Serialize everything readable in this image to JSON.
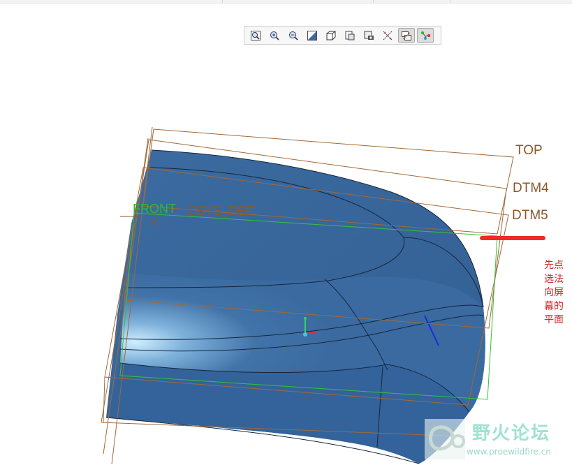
{
  "toolbar": {
    "buttons": [
      {
        "icon": "refit-icon",
        "active": false
      },
      {
        "icon": "zoom-in-icon",
        "active": false
      },
      {
        "icon": "zoom-out-icon",
        "active": false
      },
      {
        "icon": "repaint-icon",
        "active": false
      },
      {
        "icon": "display-style-icon",
        "active": false
      },
      {
        "icon": "saved-orientations-icon",
        "active": false
      },
      {
        "icon": "view-manager-icon",
        "active": false
      },
      {
        "icon": "perspective-icon",
        "active": false
      },
      {
        "icon": "datum-display-icon",
        "active": true
      },
      {
        "icon": "spin-center-icon",
        "active": true
      }
    ]
  },
  "datum_labels": {
    "top": "TOP",
    "dtm4": "DTM4",
    "dtm5": "DTM5",
    "front": "FRONT",
    "csys": "CSYS_DEF"
  },
  "annotation": {
    "text": "先点选法向屏幕的平面",
    "color": "#d42a2a"
  },
  "watermark": {
    "title": "野火论坛",
    "url": "www.proewildfire.cn"
  },
  "colors": {
    "model_surface": "#3a6aa0",
    "model_dark": "#2d5687",
    "datum_brown": "#a0693a",
    "datum_green": "#33c33a",
    "label_brown": "#8a5a2b",
    "label_green": "#2fb82f",
    "red_marker": "#ee2b2b"
  }
}
